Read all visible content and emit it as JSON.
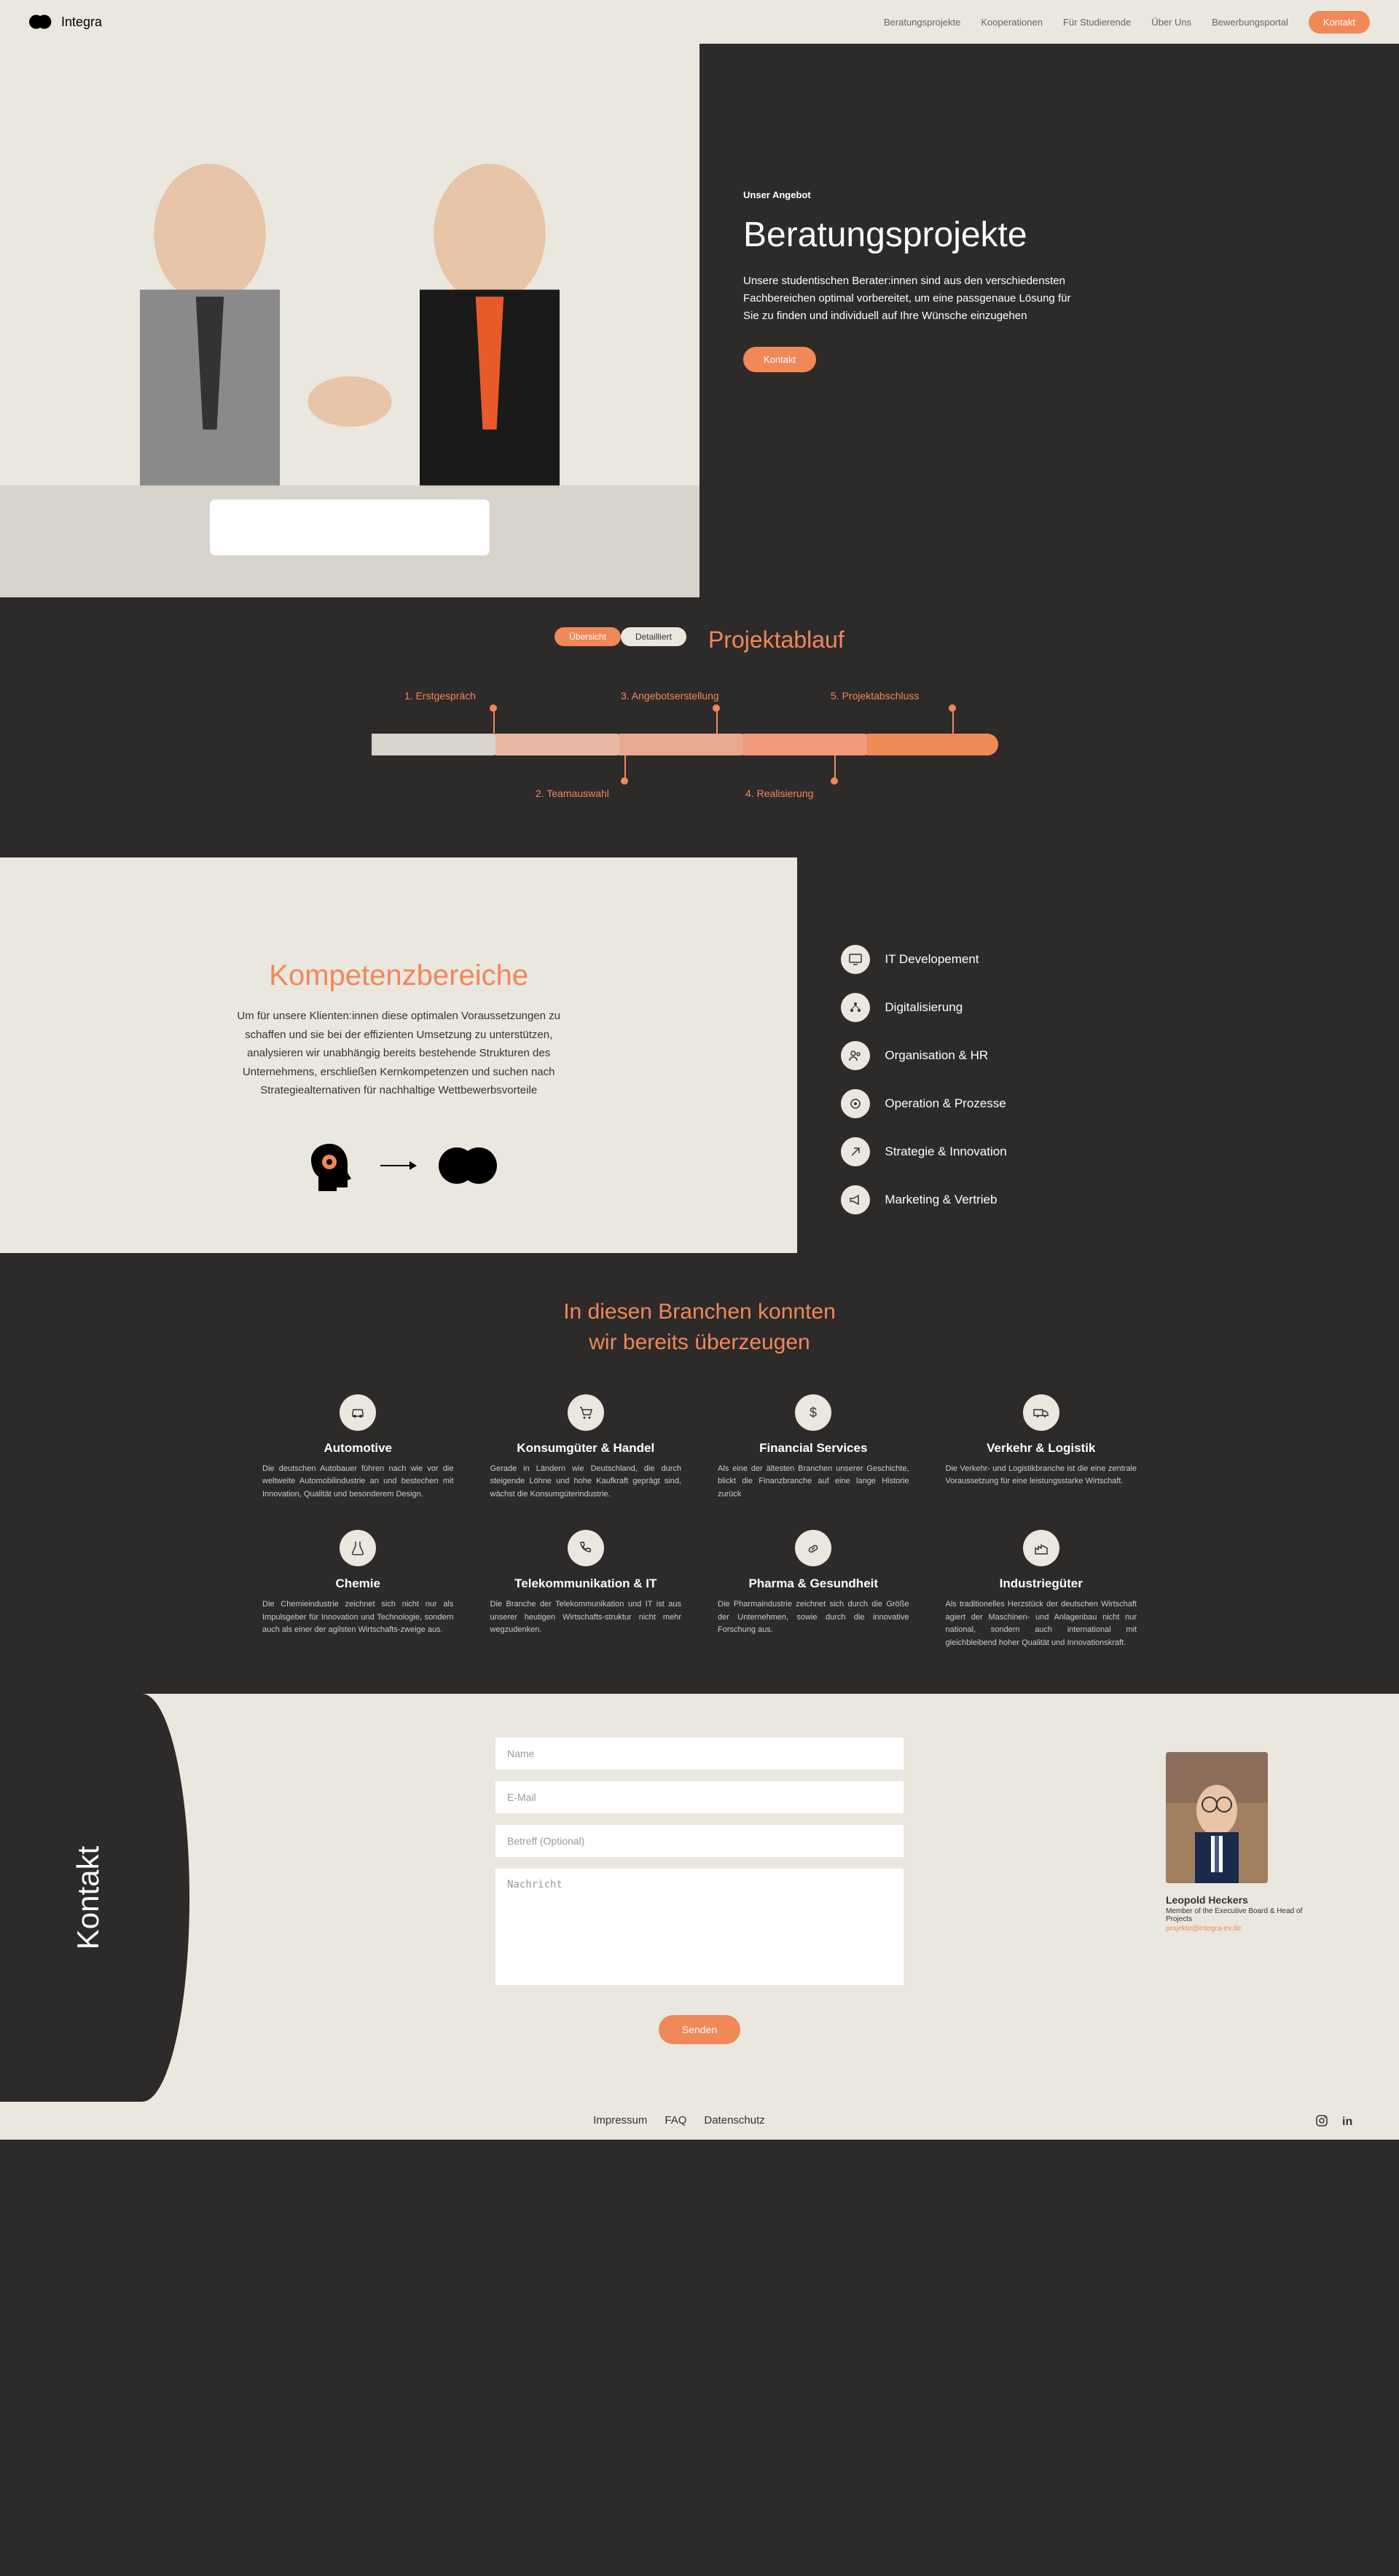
{
  "brand": "Integra",
  "nav": {
    "items": [
      "Beratungsprojekte",
      "Kooperationen",
      "Für Studierende",
      "Über Uns",
      "Bewerbungsportal"
    ],
    "cta": "Kontakt"
  },
  "hero": {
    "kicker": "Unser Angebot",
    "title": "Beratungsprojekte",
    "text": "Unsere studentischen Berater:innen sind aus den verschiedensten Fachbereichen optimal vorbereitet, um eine passgenaue Lösung für Sie zu finden und individuell auf Ihre Wünsche einzugehen",
    "cta": "Kontakt"
  },
  "timeline": {
    "toggle_active": "Übersicht",
    "toggle_inactive": "Detailliert",
    "title": "Projektablauf",
    "steps": [
      "1. Erstgespräch",
      "2. Teamauswahl",
      "3. Angebotserstellung",
      "4. Realisierung",
      "5. Projektabschluss"
    ]
  },
  "kompetenz": {
    "title": "Kompetenzbereiche",
    "text": "Um für unsere Klienten:innen diese optimalen Voraussetzungen zu schaffen und sie bei der effizienten Umsetzung zu unterstützen, analysieren wir unabhängig bereits bestehende Strukturen des Unternehmens, erschließen Kernkompetenzen und suchen nach Strategiealternativen für nachhaltige Wettbewerbsvorteile",
    "items": [
      "IT Developement",
      "Digitalisierung",
      "Organisation & HR",
      "Operation & Prozesse",
      "Strategie & Innovation",
      "Marketing & Vertrieb"
    ]
  },
  "branchen": {
    "title_l1": "In diesen Branchen konnten",
    "title_l2": "wir bereits überzeugen",
    "cards": [
      {
        "title": "Automotive",
        "text": "Die deutschen Autobauer führen nach wie vor die weltweite Automobilindustrie an und bestechen mit Innovation, Qualität und besonderem Design."
      },
      {
        "title": "Konsumgüter & Handel",
        "text": "Gerade in Ländern wie Deutschland, die durch steigende Löhne und hohe Kaufkraft geprägt sind, wächst die Konsumgüterindustrie."
      },
      {
        "title": "Financial Services",
        "text": "Als eine der ältesten Branchen unserer Geschichte, blickt die Finanzbranche auf eine lange Historie zurück"
      },
      {
        "title": "Verkehr & Logistik",
        "text": "Die Verkehr- und Logistikbranche ist die eine zentrale Voraussetzung für eine leistungsstarke Wirtschaft."
      },
      {
        "title": "Chemie",
        "text": "Die Chemieindustrie zeichnet sich nicht nur als Impulsgeber für Innovation und Technologie, sondern auch als einer der agilsten Wirtschafts-zweige aus."
      },
      {
        "title": "Telekommunikation & IT",
        "text": "Die Branche der Telekommunikation und IT ist aus unserer heutigen Wirtschafts-struktur nicht mehr wegzudenken."
      },
      {
        "title": "Pharma & Gesundheit",
        "text": "Die Pharmaindustrie zeichnet sich durch die Größe der Unternehmen, sowie durch die innovative Forschung aus."
      },
      {
        "title": "Industriegüter",
        "text": "Als traditionelles Herzstück der deutschen Wirtschaft agiert der Maschinen- und Anlagenbau nicht nur national, sondern auch international mit gleichbleibend hoher Qualität und Innovationskraft."
      }
    ]
  },
  "kontakt": {
    "heading": "Kontakt",
    "placeholders": {
      "name": "Name",
      "email": "E-Mail",
      "subject": "Betreff (Optional)",
      "message": "Nachricht"
    },
    "submit": "Senden",
    "person": {
      "name": "Leopold Heckers",
      "role": "Member of the Executive Board & Head of Projects",
      "email": "projekte@integra-ev.de"
    }
  },
  "footer": {
    "links": [
      "Impressum",
      "FAQ",
      "Datenschutz"
    ]
  }
}
